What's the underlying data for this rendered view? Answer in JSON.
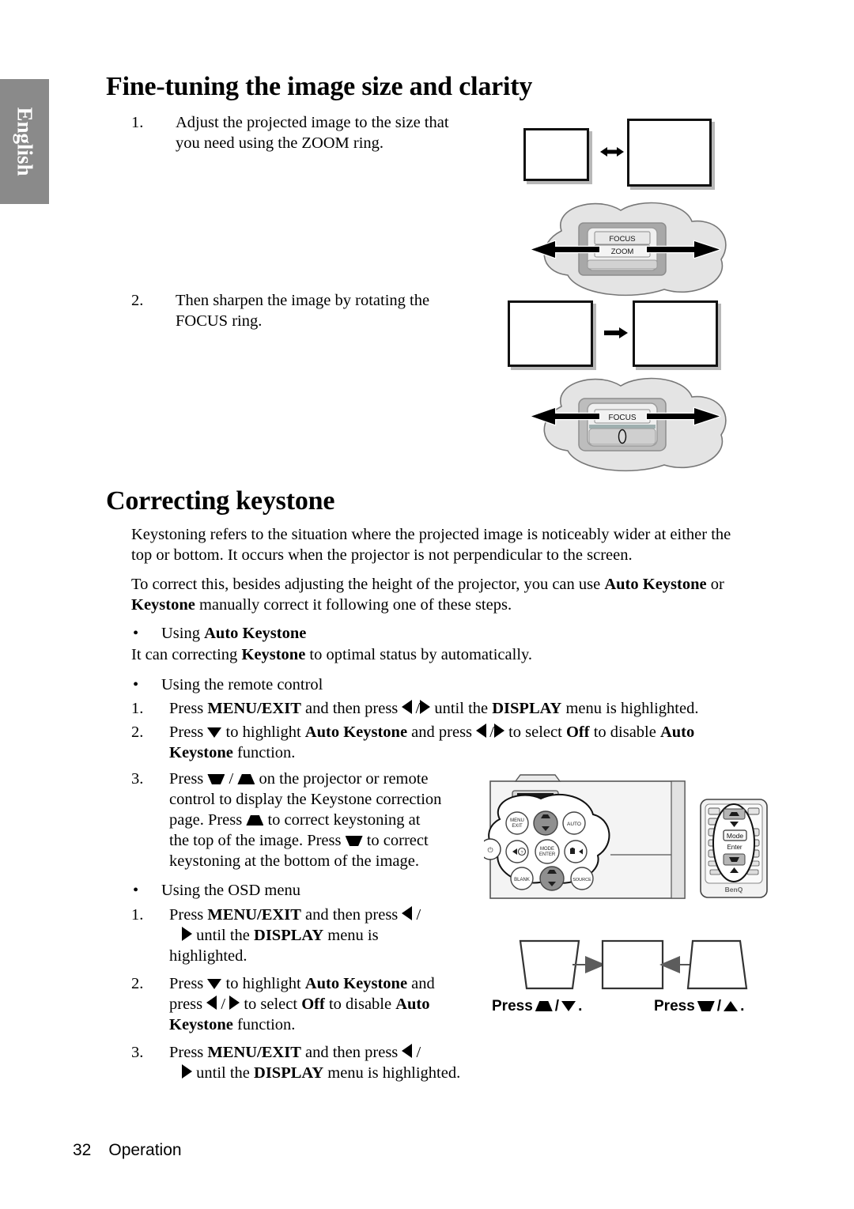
{
  "sidebar": {
    "language_tab": "English"
  },
  "headings": {
    "fine_tuning": "Fine-tuning the image size and clarity",
    "correcting_keystone": "Correcting keystone"
  },
  "fine_tuning_steps": [
    {
      "number": "1.",
      "line1": "Adjust the projected image to the size that",
      "line2": "you need using the ZOOM ring."
    },
    {
      "number": "2.",
      "line1": "Then sharpen the image by rotating the",
      "line2": "FOCUS ring."
    }
  ],
  "lens_diagram_zoom": {
    "label_focus": "FOCUS",
    "label_zoom": "ZOOM"
  },
  "lens_diagram_focus": {
    "label_focus": "FOCUS"
  },
  "keystone_intro": {
    "paragraph1_line1": "Keystoning refers to the situation where the projected image is noticeably wider at either the",
    "paragraph1_line2": "top or bottom. It occurs when the projector is not perpendicular to the screen.",
    "paragraph2_line1_a": "To correct this, besides adjusting the height of the projector, you can use ",
    "paragraph2_line1_b": "Auto Keystone",
    "paragraph2_line1_c": " or",
    "paragraph2_line2_a": "Keystone",
    "paragraph2_line2_b": " manually correct it following one of these steps."
  },
  "auto_keystone": {
    "bullet_prefix": "Using ",
    "bullet_bold": "Auto Keystone",
    "body_a": "It can correcting ",
    "body_bold": "Keystone",
    "body_b": " to optimal status by automatically."
  },
  "remote_section": {
    "bullet": "Using the remote control",
    "steps": [
      {
        "number": "1.",
        "a": "Press ",
        "b_menu": "MENU/EXIT",
        "c": " and then press ",
        "d": " until the ",
        "e_display": "DISPLAY",
        "f": " menu is highlighted."
      },
      {
        "number": "2.",
        "a": "Press ",
        "b": " to highlight ",
        "c_auto": "Auto Keystone",
        "d": " and press ",
        "e": " to select ",
        "f_off": "Off",
        "g": " to disable ",
        "h_auto": "Auto",
        "line2_bold": "Keystone",
        "line2_rest": " function."
      },
      {
        "number": "3.",
        "l1a": "Press ",
        "l1b": " / ",
        "l1c": " on the projector or remote",
        "l2": "control to display the Keystone correction",
        "l3a": "page. Press ",
        "l3b": " to correct keystoning at",
        "l4a": "the top of the image. Press ",
        "l4b": " to correct",
        "l5": "keystoning at the bottom of the image."
      }
    ]
  },
  "osd_section": {
    "bullet": "Using the OSD menu",
    "steps": [
      {
        "number": "1.",
        "l1a": "Press ",
        "l1b_menu": "MENU/EXIT",
        "l1c": " and then press ",
        "l1d": " /",
        "l2a": " until the ",
        "l2b_display": "DISPLAY",
        "l2c": " menu is",
        "l3": "highlighted."
      },
      {
        "number": "2.",
        "l1a": "Press ",
        "l1b": " to highlight ",
        "l1c_auto": "Auto Keystone",
        "l1d": " and",
        "l2a": "press ",
        "l2b": " / ",
        "l2c": " to select ",
        "l2d_off": "Off",
        "l2e": " to disable ",
        "l2f_auto": "Auto",
        "l3a_bold": "Keystone",
        "l3b": " function."
      },
      {
        "number": "3.",
        "l1a": "Press ",
        "l1b_menu": "MENU/EXIT",
        "l1c": " and then press ",
        "l1d": " /",
        "l2a": " until the ",
        "l2b_display": "DISPLAY",
        "l2c": " menu is highlighted."
      }
    ]
  },
  "projector_panel": {
    "buttons": [
      "MENU EXIT",
      "AUTO",
      "MODE ENTER",
      "BLANK",
      "SOURCE"
    ]
  },
  "remote_device": {
    "mode_label": "Mode",
    "enter_label": "Enter",
    "brand": "BenQ"
  },
  "keystone_figure": {
    "press_left_prefix": "Press",
    "press_left_suffix": ".",
    "press_right_prefix": "Press",
    "press_right_suffix": "."
  },
  "footer": {
    "page_number": "32",
    "section": "Operation"
  }
}
